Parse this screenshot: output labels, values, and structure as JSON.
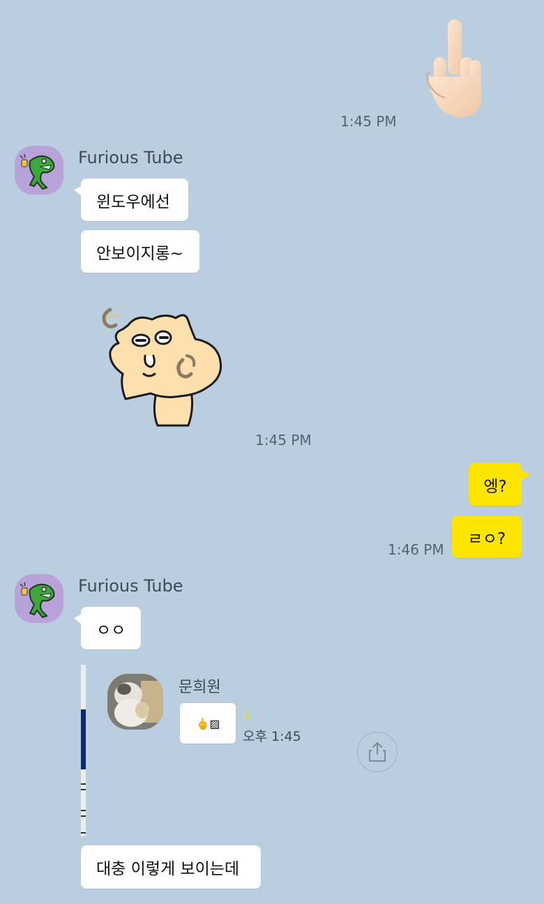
{
  "messages": {
    "msg1": {
      "emoji": "🖕🏻",
      "time": "1:45 PM"
    },
    "group1": {
      "sender": "Furious Tube",
      "bubble1": "윈도우에선",
      "bubble2": "안보이지롱~",
      "time": "1:45 PM"
    },
    "mine": {
      "bubble1": "엥?",
      "bubble2": "ㄹㅇ?",
      "time": "1:46 PM"
    },
    "group2": {
      "sender": "Furious Tube",
      "bubble1": "ㅇㅇ",
      "screenshot": {
        "name": "문희원",
        "bubble": "🖕▨",
        "unread": "1",
        "time": "오후 1:45"
      },
      "bubble2": "대충 이렇게 보이는데"
    }
  },
  "icons": {
    "avatar": "crocodile-character-icon",
    "sticker": "bear-character-sticker",
    "share": "share-icon"
  },
  "colors": {
    "background": "#bacee0",
    "my_bubble": "#fee500",
    "their_bubble": "#ffffff",
    "avatar_bg": "#b8a2d9",
    "unread": "#f5d300"
  }
}
